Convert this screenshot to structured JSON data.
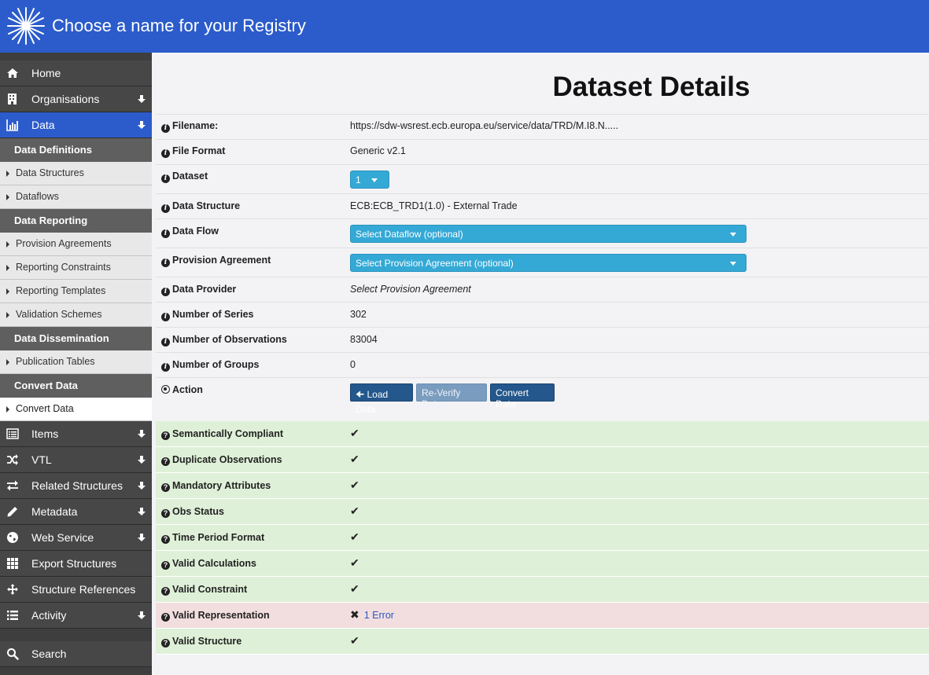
{
  "header": {
    "title": "Choose a name for your Registry"
  },
  "sidebar": {
    "home": "Home",
    "organisations": "Organisations",
    "data": "Data",
    "data_definitions": "Data Definitions",
    "data_structures": "Data Structures",
    "dataflows": "Dataflows",
    "data_reporting": "Data Reporting",
    "provision_agreements": "Provision Agreements",
    "reporting_constraints": "Reporting Constraints",
    "reporting_templates": "Reporting Templates",
    "validation_schemes": "Validation Schemes",
    "data_dissemination": "Data Dissemination",
    "publication_tables": "Publication Tables",
    "convert_data_header": "Convert Data",
    "convert_data": "Convert Data",
    "items": "Items",
    "vtl": "VTL",
    "related_structures": "Related Structures",
    "metadata": "Metadata",
    "web_service": "Web Service",
    "export_structures": "Export Structures",
    "structure_references": "Structure References",
    "activity": "Activity",
    "search": "Search"
  },
  "main": {
    "title": "Dataset Details",
    "filename_label": "Filename:",
    "filename_value": "https://sdw-wsrest.ecb.europa.eu/service/data/TRD/M.I8.N.....",
    "file_format_label": "File Format",
    "file_format_value": "Generic v2.1",
    "dataset_label": "Dataset",
    "dataset_value": "1",
    "data_structure_label": "Data Structure",
    "data_structure_value": "ECB:ECB_TRD1(1.0) - External Trade",
    "data_flow_label": "Data Flow",
    "data_flow_value": "Select Dataflow (optional)",
    "provision_agreement_label": "Provision Agreement",
    "provision_agreement_value": "Select Provision Agreement (optional)",
    "data_provider_label": "Data Provider",
    "data_provider_value": "Select Provision Agreement",
    "num_series_label": "Number of Series",
    "num_series_value": "302",
    "num_obs_label": "Number of Observations",
    "num_obs_value": "83004",
    "num_groups_label": "Number of Groups",
    "num_groups_value": "0",
    "action_label": "Action",
    "load_data": "Load Data",
    "reverify_data": "Re-Verify Data",
    "convert_data": "Convert Data"
  },
  "validation": {
    "semantically_compliant": "Semantically Compliant",
    "duplicate_observations": "Duplicate Observations",
    "mandatory_attributes": "Mandatory Attributes",
    "obs_status": "Obs Status",
    "time_period_format": "Time Period Format",
    "valid_calculations": "Valid Calculations",
    "valid_constraint": "Valid Constraint",
    "valid_representation": "Valid Representation",
    "valid_representation_error": "1 Error",
    "valid_structure": "Valid Structure"
  },
  "colors": {
    "header": "#2c5ccb",
    "success": "#dff0d8",
    "error": "#f2dede",
    "select": "#34a9d6",
    "button": "#24578b"
  }
}
